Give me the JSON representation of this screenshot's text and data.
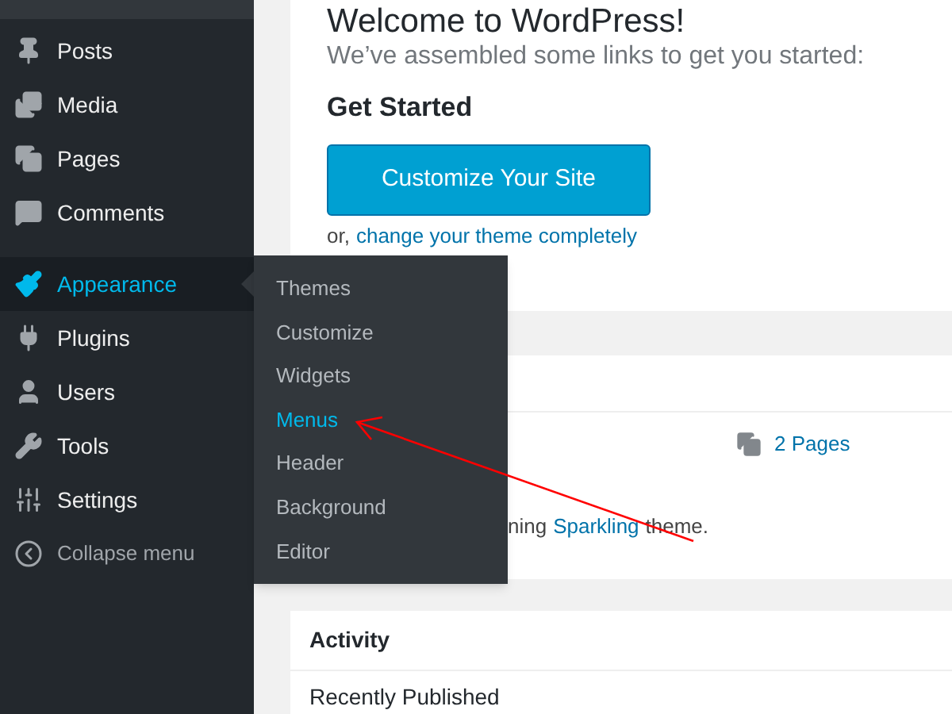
{
  "sidebar": {
    "groups": [
      [
        {
          "label": "Posts",
          "selected": false
        },
        {
          "label": "Media",
          "selected": false
        },
        {
          "label": "Pages",
          "selected": false
        },
        {
          "label": "Comments",
          "selected": false
        }
      ],
      [
        {
          "label": "Appearance",
          "selected": true
        },
        {
          "label": "Plugins",
          "selected": false
        },
        {
          "label": "Users",
          "selected": false
        },
        {
          "label": "Tools",
          "selected": false
        },
        {
          "label": "Settings",
          "selected": false
        }
      ]
    ],
    "collapse": "Collapse menu"
  },
  "flyout": {
    "items": [
      {
        "label": "Themes",
        "selected": false
      },
      {
        "label": "Customize",
        "selected": false
      },
      {
        "label": "Widgets",
        "selected": false
      },
      {
        "label": "Menus",
        "selected": true
      },
      {
        "label": "Header",
        "selected": false
      },
      {
        "label": "Background",
        "selected": false
      },
      {
        "label": "Editor",
        "selected": false
      }
    ]
  },
  "welcome": {
    "title": "Welcome to WordPress!",
    "subtitle": "We’ve assembled some links to get you started:",
    "heading": "Get Started",
    "button": "Customize Your Site",
    "alt_prefix": "or,",
    "alt_link": "change your theme completely"
  },
  "glance": {
    "pages": "2 Pages",
    "theme_prefix": "ning",
    "theme_link": "Sparkling",
    "theme_suffix": "theme."
  },
  "activity": {
    "title": "Activity",
    "section": "Recently Published"
  }
}
